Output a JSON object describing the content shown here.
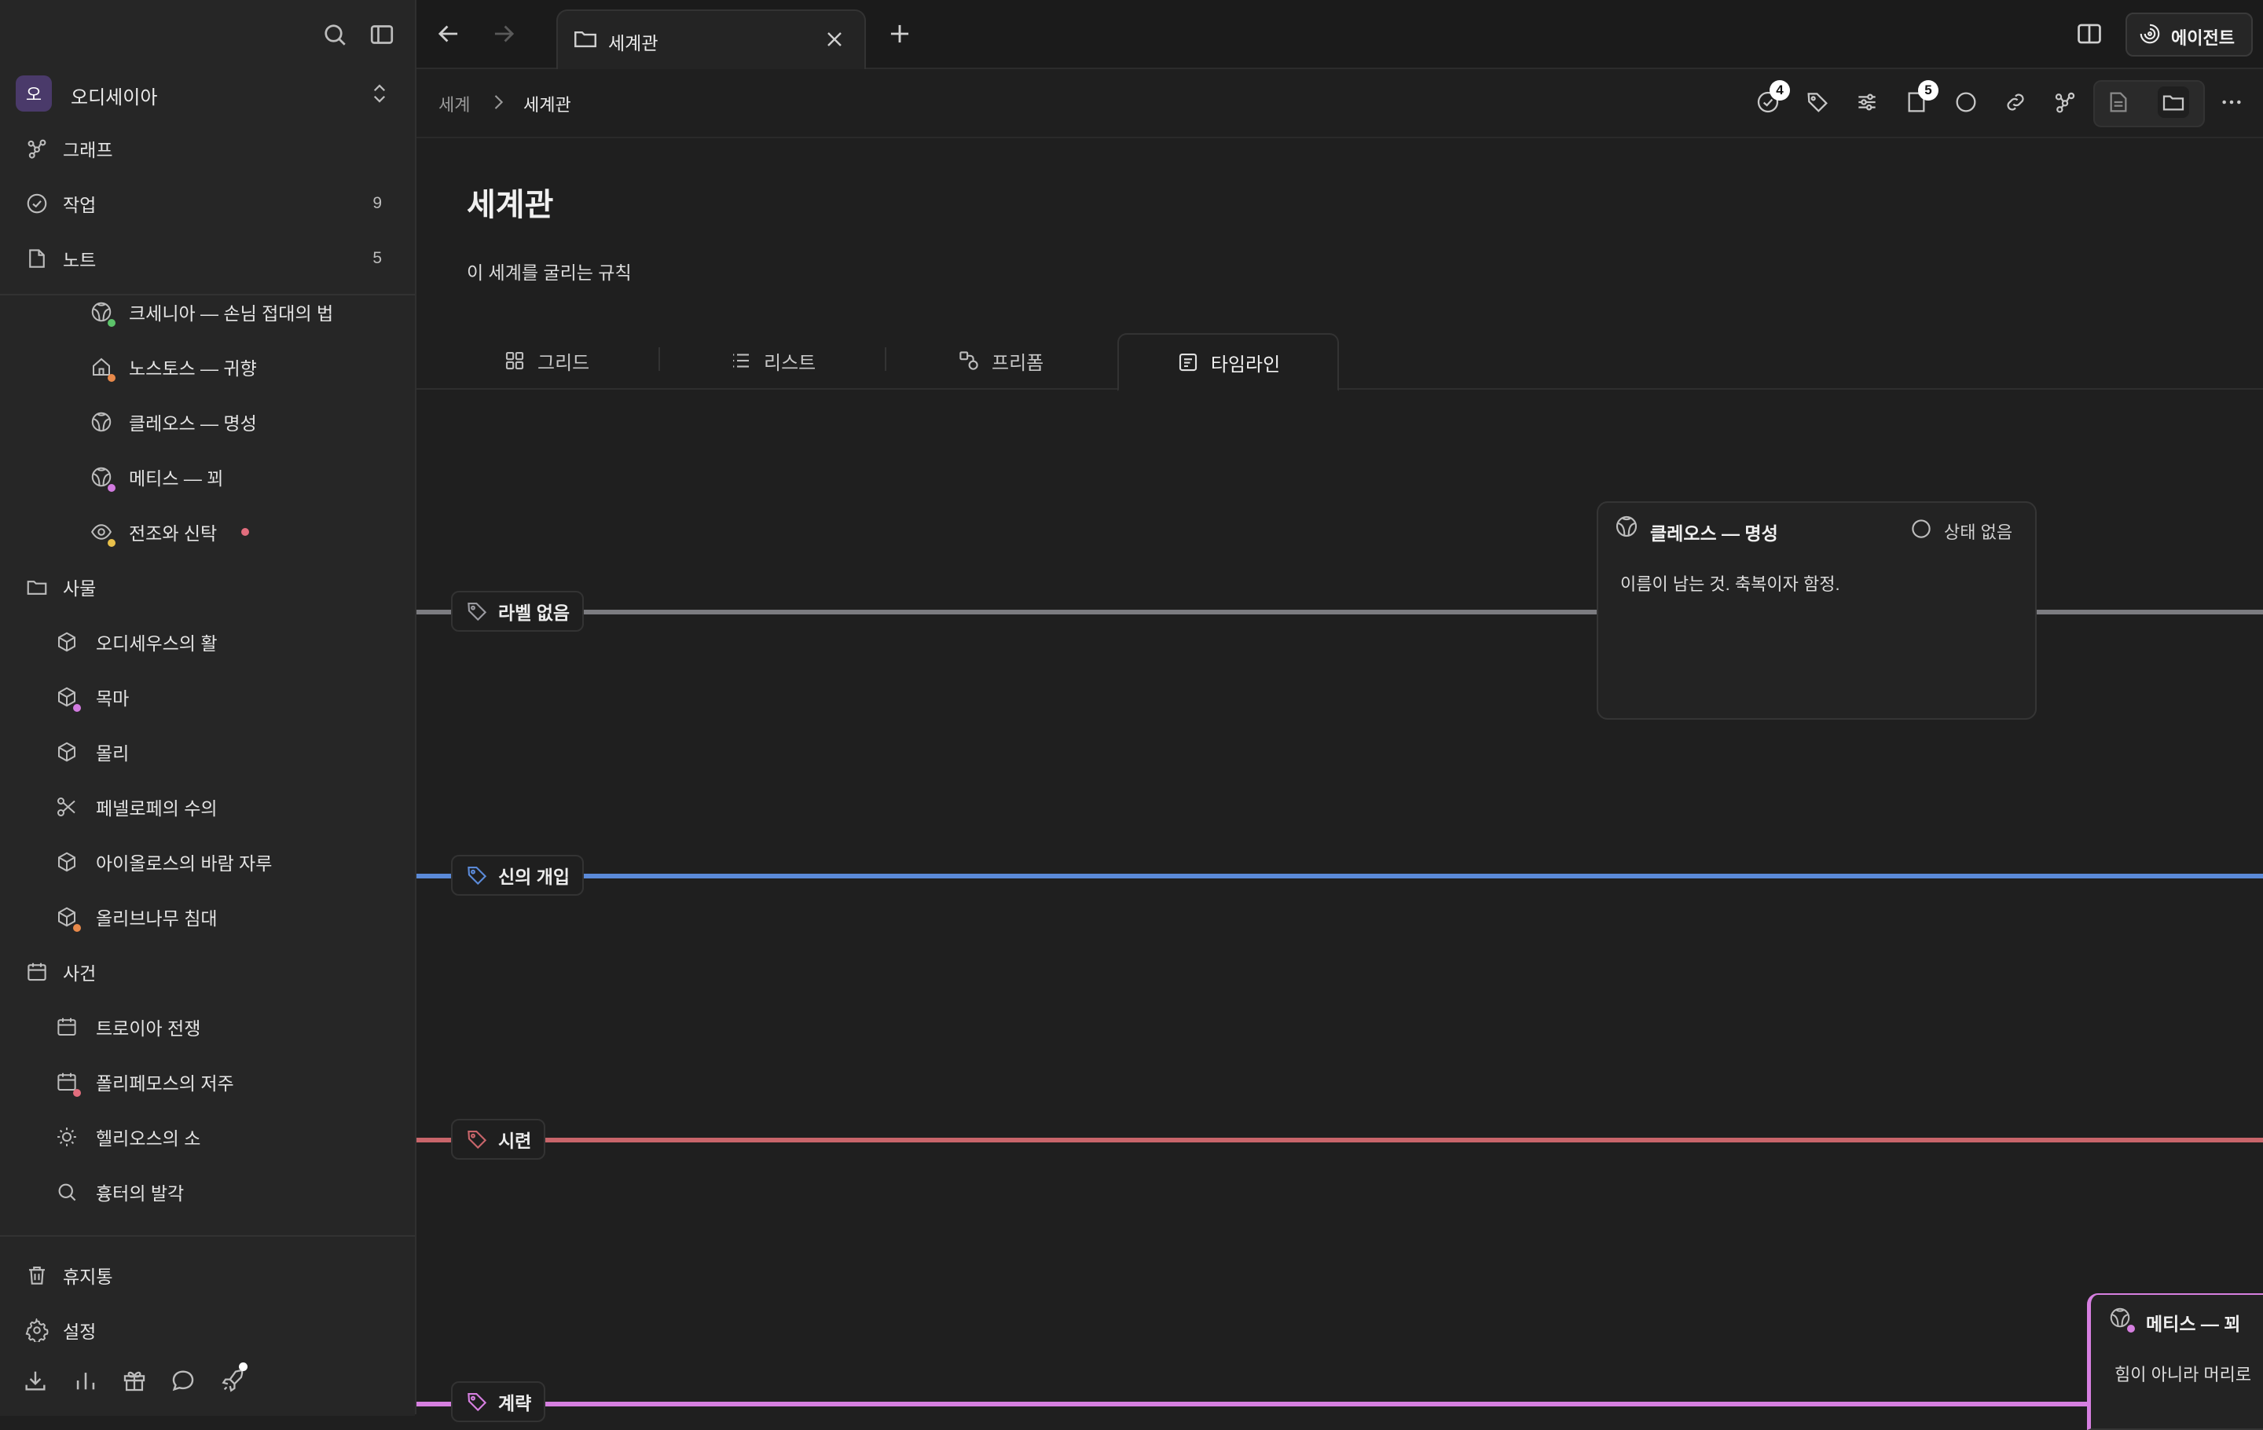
{
  "workspace": {
    "initial": "오",
    "name": "오디세이아"
  },
  "sidebar": {
    "top_items": [
      {
        "label": "그래프",
        "count": ""
      },
      {
        "label": "작업",
        "count": "9"
      },
      {
        "label": "노트",
        "count": "5"
      }
    ],
    "notes_children": [
      {
        "label": "크세니아 — 손님 접대의 법",
        "dot": "#5cc36a"
      },
      {
        "label": "노스토스 — 귀향",
        "dot": "#e8894a"
      },
      {
        "label": "클레오스 — 명성",
        "dot": ""
      },
      {
        "label": "메티스 — 꾀",
        "dot": "#d27be0"
      },
      {
        "label": "전조와 신탁",
        "dot": "#e8c04a",
        "trail_dot": "#e26d7d"
      }
    ],
    "things": {
      "label": "사물",
      "children": [
        {
          "label": "오디세우스의 활",
          "dot": ""
        },
        {
          "label": "목마",
          "dot": "#d27be0"
        },
        {
          "label": "몰리",
          "dot": ""
        },
        {
          "label": "페넬로페의 수의",
          "dot": ""
        },
        {
          "label": "아이올로스의 바람 자루",
          "dot": ""
        },
        {
          "label": "올리브나무 침대",
          "dot": "#e8894a"
        }
      ]
    },
    "events": {
      "label": "사건",
      "children": [
        {
          "label": "트로이아 전쟁",
          "dot": ""
        },
        {
          "label": "폴리페모스의 저주",
          "dot": "#e26d7d"
        },
        {
          "label": "헬리오스의 소",
          "dot": ""
        },
        {
          "label": "흉터의 발각",
          "dot": ""
        }
      ]
    },
    "bottom_items": [
      {
        "label": "휴지통"
      },
      {
        "label": "설정"
      }
    ]
  },
  "topbar": {
    "tab_title": "세계관",
    "agent_label": "에이전트"
  },
  "header": {
    "breadcrumb_parent": "세계",
    "breadcrumb_current": "세계관",
    "tasks_badge": "4",
    "pages_badge": "5"
  },
  "page": {
    "title": "세계관",
    "description": "이 세계를 굴리는 규칙"
  },
  "views": [
    {
      "label": "그리드",
      "active": false
    },
    {
      "label": "리스트",
      "active": false
    },
    {
      "label": "프리폼",
      "active": false
    },
    {
      "label": "타임라인",
      "active": true
    }
  ],
  "timeline": {
    "lanes": [
      {
        "label": "라벨 없음",
        "color": "#7c7c80"
      },
      {
        "label": "신의 개입",
        "color": "#5b8ad8"
      },
      {
        "label": "시련",
        "color": "#c8656a"
      },
      {
        "label": "계략",
        "color": "#d67fe0"
      }
    ],
    "cards": [
      {
        "title": "클레오스 — 명성",
        "status": "상태 없음",
        "body": "이름이 남는 것. 축복이자 함정."
      },
      {
        "title": "메티스 — 꾀",
        "body": "힘이 아니라 머리로"
      }
    ]
  },
  "colors": {
    "accent_purple": "#4a3a6a",
    "background": "#1f1f1f",
    "sidebar": "#262626"
  }
}
